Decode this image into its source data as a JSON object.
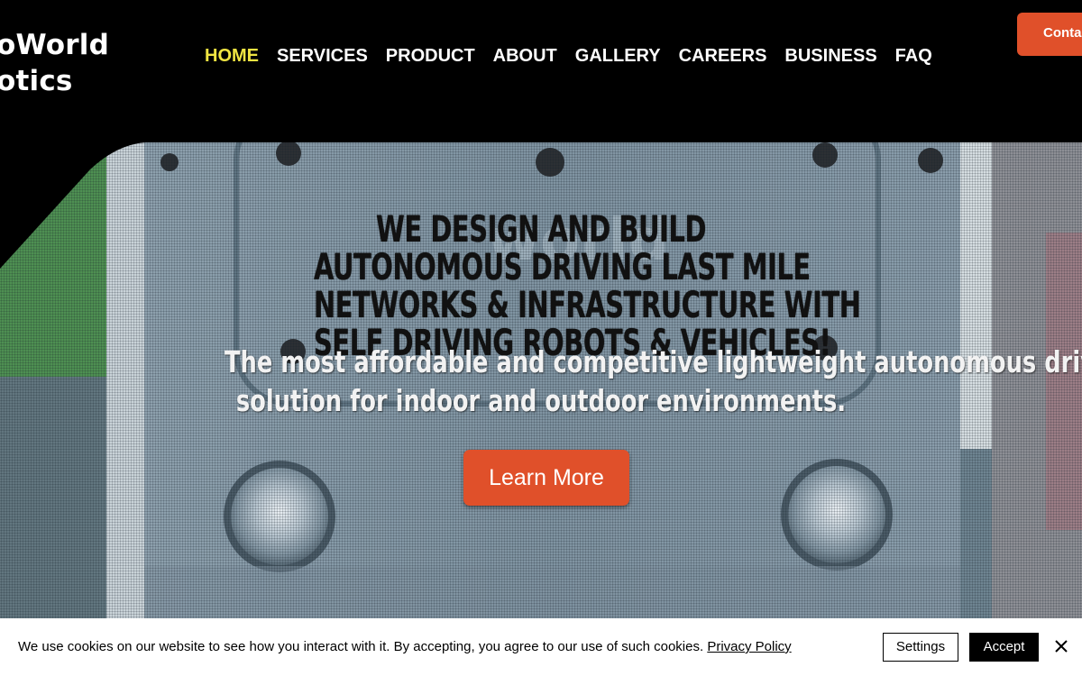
{
  "logo": {
    "line1": "oWorld",
    "line2": "otics"
  },
  "nav": {
    "items": [
      {
        "label": "HOME",
        "active": true
      },
      {
        "label": "SERVICES"
      },
      {
        "label": "PRODUCT"
      },
      {
        "label": "ABOUT"
      },
      {
        "label": "GALLERY"
      },
      {
        "label": "CAREERS"
      },
      {
        "label": "BUSINESS"
      },
      {
        "label": "FAQ"
      }
    ],
    "contact_label": "Contac"
  },
  "hero": {
    "headline_lines": [
      "WE DESIGN AND BUILD",
      "AUTONOMOUS DRIVING LAST MILE",
      "NETWORKS & INFRASTRUCTURE WITH",
      "SELF DRIVING ROBOTS & VEHICLES!"
    ],
    "subline_lines": [
      "The most affordable and competitive lightweight autonomous driving",
      "solution for indoor and outdoor environments."
    ],
    "cta_label": "Learn More",
    "background_icon": "robot-photo"
  },
  "cookie": {
    "text": "We use cookies on our website to see how you interact with it. By accepting, you agree to our use of such cookies.",
    "policy_link": "Privacy Policy",
    "settings_label": "Settings",
    "accept_label": "Accept",
    "close_icon": "close-icon"
  },
  "colors": {
    "accent": "#e0502a",
    "nav_active": "#f0e442",
    "header_bg": "#000000"
  }
}
